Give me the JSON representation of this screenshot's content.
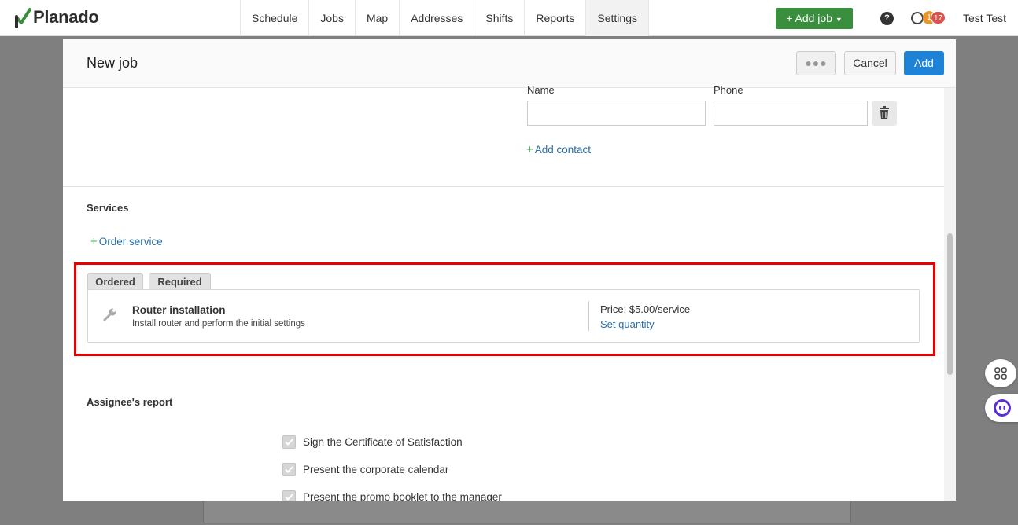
{
  "app": {
    "logo_text": "Planado",
    "brand_color": "#3a8f3e",
    "user_name": "Test Test"
  },
  "nav": {
    "items": [
      {
        "label": "Schedule"
      },
      {
        "label": "Jobs"
      },
      {
        "label": "Map"
      },
      {
        "label": "Addresses"
      },
      {
        "label": "Shifts"
      },
      {
        "label": "Reports"
      },
      {
        "label": "Settings"
      }
    ],
    "active": "Settings",
    "add_job_label": "Add job",
    "help_glyph": "?",
    "badge_orange": "1",
    "badge_red": "17",
    "badge_orange_color": "#e8962e",
    "badge_red_color": "#d9534f"
  },
  "modal": {
    "title": "New job",
    "more_glyph": "●●●",
    "cancel_label": "Cancel",
    "add_label": "Add",
    "add_color": "#1e82d6"
  },
  "contact": {
    "name_label": "Name",
    "phone_label": "Phone",
    "name_value": "",
    "phone_value": "",
    "add_contact_label": "Add contact"
  },
  "services": {
    "section_title": "Services",
    "order_service_label": "Order service",
    "tabs": [
      "Ordered",
      "Required"
    ],
    "highlight_color": "#e60000",
    "item": {
      "name": "Router installation",
      "description": "Install router and perform the initial settings",
      "price": "Price: $5.00/service",
      "set_quantity_label": "Set quantity"
    }
  },
  "report": {
    "section_title": "Assignee's report",
    "items": [
      {
        "label": "Sign the Certificate of Satisfaction",
        "checked": true
      },
      {
        "label": "Present the corporate calendar",
        "checked": true
      },
      {
        "label": "Present the promo booklet to the manager",
        "checked": true
      }
    ]
  },
  "icons": {
    "logo": "checkmark-logo-icon",
    "help": "question-icon",
    "clock": "clock-icon",
    "trash": "trash-icon",
    "wrench": "wrench-icon",
    "apps": "apps-grid-icon",
    "chat": "chat-bot-icon"
  }
}
